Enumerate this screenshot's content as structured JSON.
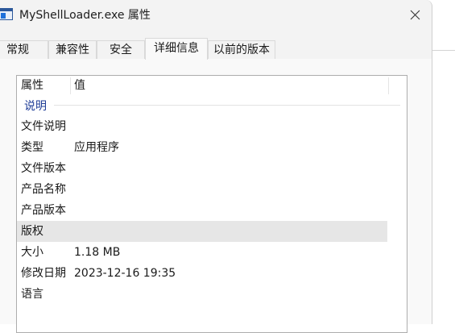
{
  "window": {
    "title": "MyShellLoader.exe 属性",
    "icon": "app-window-icon",
    "close_icon": "close-icon"
  },
  "tabs": [
    {
      "label": "常规",
      "active": false
    },
    {
      "label": "兼容性",
      "active": false
    },
    {
      "label": "安全",
      "active": false
    },
    {
      "label": "详细信息",
      "active": true
    },
    {
      "label": "以前的版本",
      "active": false
    }
  ],
  "details": {
    "columns": {
      "property": "属性",
      "value": "值"
    },
    "group_label": "说明",
    "rows": [
      {
        "property": "文件说明",
        "value": ""
      },
      {
        "property": "类型",
        "value": "应用程序"
      },
      {
        "property": "文件版本",
        "value": ""
      },
      {
        "property": "产品名称",
        "value": ""
      },
      {
        "property": "产品版本",
        "value": ""
      },
      {
        "property": "版权",
        "value": "",
        "selected": true
      },
      {
        "property": "大小",
        "value": "1.18 MB"
      },
      {
        "property": "修改日期",
        "value": "2023-12-16 19:35"
      },
      {
        "property": "语言",
        "value": ""
      }
    ]
  },
  "colors": {
    "group_label": "#1e3c96",
    "selected_row": "#e6e6e6",
    "window_bg": "#f3f3f3",
    "panel_bg": "#f9f9f9"
  }
}
